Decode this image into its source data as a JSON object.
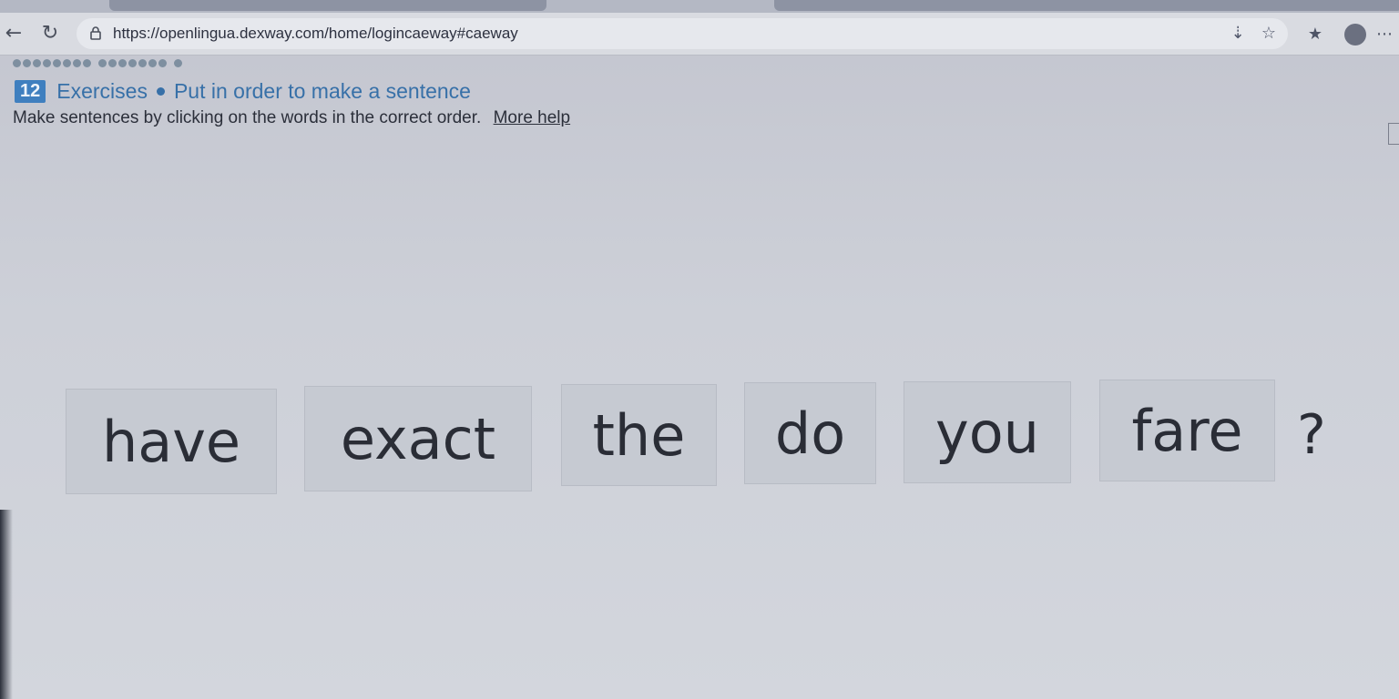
{
  "browser": {
    "url": "https://openlingua.dexway.com/home/logincaeway#caeway",
    "back_icon": "arrow-left-icon",
    "reload_icon": "reload-icon",
    "lock_icon": "lock-icon",
    "download_icon": "download-icon",
    "bookmark_icon": "star-icon",
    "favorites_icon": "favorites-icon",
    "profile_icon": "avatar",
    "menu_icon": "more-icon"
  },
  "exercise": {
    "number": "12",
    "section": "Exercises",
    "title": "Put in order to make a sentence",
    "instructions": "Make sentences by clicking on the words in the correct order.",
    "help_link": "More help",
    "words": [
      "have",
      "exact",
      "the",
      "do",
      "you",
      "fare"
    ],
    "punctuation": "?"
  },
  "colors": {
    "accent": "#3770a8",
    "badge": "#3f7fbf",
    "tile_bg": "#c6cad2",
    "text": "#2a2d36"
  }
}
